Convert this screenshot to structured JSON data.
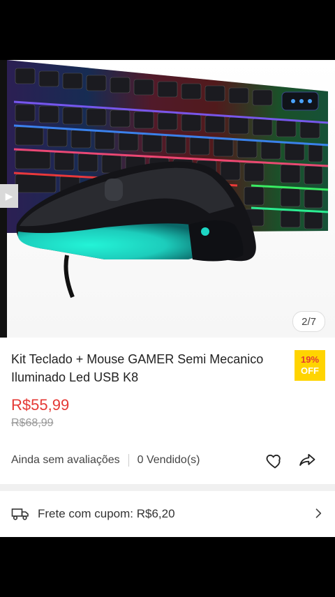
{
  "gallery": {
    "counter": "2/7",
    "alt": "Kit teclado e mouse gamer iluminado"
  },
  "product": {
    "title": "Kit Teclado + Mouse GAMER Semi Mecanico Iluminado Led USB K8",
    "badge_percent": "19%",
    "badge_label": "OFF",
    "price": "R$55,99",
    "old_price": "R$68,99",
    "reviews": "Ainda sem avaliações",
    "sold": "0 Vendido(s)"
  },
  "shipping": {
    "text": "Frete com cupom: R$6,20"
  },
  "icons": [
    "heart-icon",
    "share-icon",
    "truck-icon",
    "chevron-right-icon"
  ],
  "colors": {
    "price": "#e53935",
    "badge": "#ffd400"
  }
}
